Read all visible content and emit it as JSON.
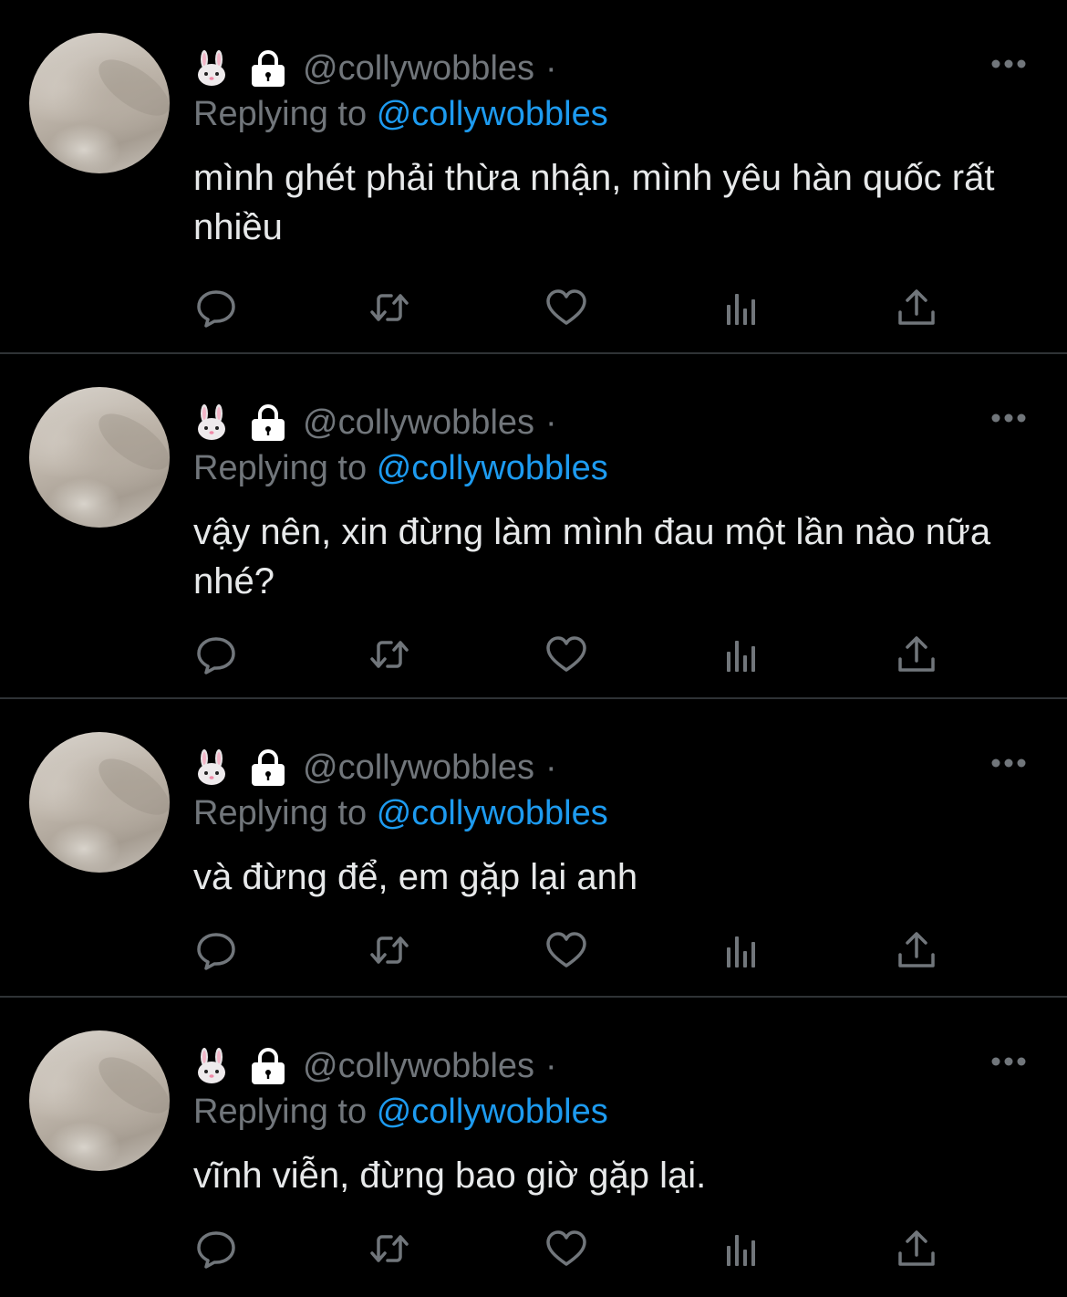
{
  "colors": {
    "background": "#000000",
    "text": "#e7e9ea",
    "muted": "#71767b",
    "accent": "#1d9bf0",
    "divider": "#2f3336"
  },
  "tweets": [
    {
      "header": {
        "emoji": "rabbit-face-emoji",
        "lock": "lock-icon",
        "handle": "@collywobbles",
        "separator": "·"
      },
      "reply": {
        "prefix": "Replying to",
        "mention": "@collywobbles"
      },
      "text": "mình ghét phải thừa nhận, mình yêu hàn quốc rất nhiều",
      "actions": [
        "reply-icon",
        "retweet-icon",
        "like-icon",
        "views-icon",
        "share-icon"
      ]
    },
    {
      "header": {
        "emoji": "rabbit-face-emoji",
        "lock": "lock-icon",
        "handle": "@collywobbles",
        "separator": "·"
      },
      "reply": {
        "prefix": "Replying to",
        "mention": "@collywobbles"
      },
      "text": "vậy nên, xin đừng làm mình đau một lần nào nữa nhé?",
      "actions": [
        "reply-icon",
        "retweet-icon",
        "like-icon",
        "views-icon",
        "share-icon"
      ]
    },
    {
      "header": {
        "emoji": "rabbit-face-emoji",
        "lock": "lock-icon",
        "handle": "@collywobbles",
        "separator": "·"
      },
      "reply": {
        "prefix": "Replying to",
        "mention": "@collywobbles"
      },
      "text": "và đừng để, em gặp lại anh",
      "actions": [
        "reply-icon",
        "retweet-icon",
        "like-icon",
        "views-icon",
        "share-icon"
      ]
    },
    {
      "header": {
        "emoji": "rabbit-face-emoji",
        "lock": "lock-icon",
        "handle": "@collywobbles",
        "separator": "·"
      },
      "reply": {
        "prefix": "Replying to",
        "mention": "@collywobbles"
      },
      "text": "vĩnh viễn, đừng bao giờ gặp lại.",
      "actions": [
        "reply-icon",
        "retweet-icon",
        "like-icon",
        "views-icon",
        "share-icon"
      ]
    }
  ]
}
